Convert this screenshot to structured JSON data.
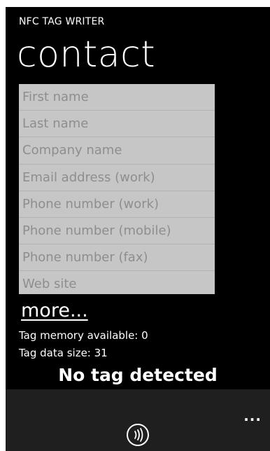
{
  "app": {
    "title": "NFC TAG WRITER",
    "page_title": "contact"
  },
  "form": {
    "fields": [
      {
        "placeholder": "First name"
      },
      {
        "placeholder": "Last name"
      },
      {
        "placeholder": "Company name"
      },
      {
        "placeholder": "Email address (work)"
      },
      {
        "placeholder": "Phone number (work)"
      },
      {
        "placeholder": "Phone number (mobile)"
      },
      {
        "placeholder": "Phone number (fax)"
      },
      {
        "placeholder": "Web site"
      }
    ]
  },
  "more_link": "more...",
  "info": {
    "memory_available": "Tag memory available: 0",
    "data_size": "Tag data size: 31"
  },
  "status": "No tag detected",
  "app_bar": {
    "button_icon": "nfc-tap-icon",
    "menu_icon": "ellipsis-icon",
    "ellipsis": "..."
  },
  "colors": {
    "background": "#000000",
    "field_background": "#c6c6c6",
    "placeholder_text": "#8e8e8e",
    "app_bar": "#1f1f1f",
    "text": "#ffffff"
  }
}
